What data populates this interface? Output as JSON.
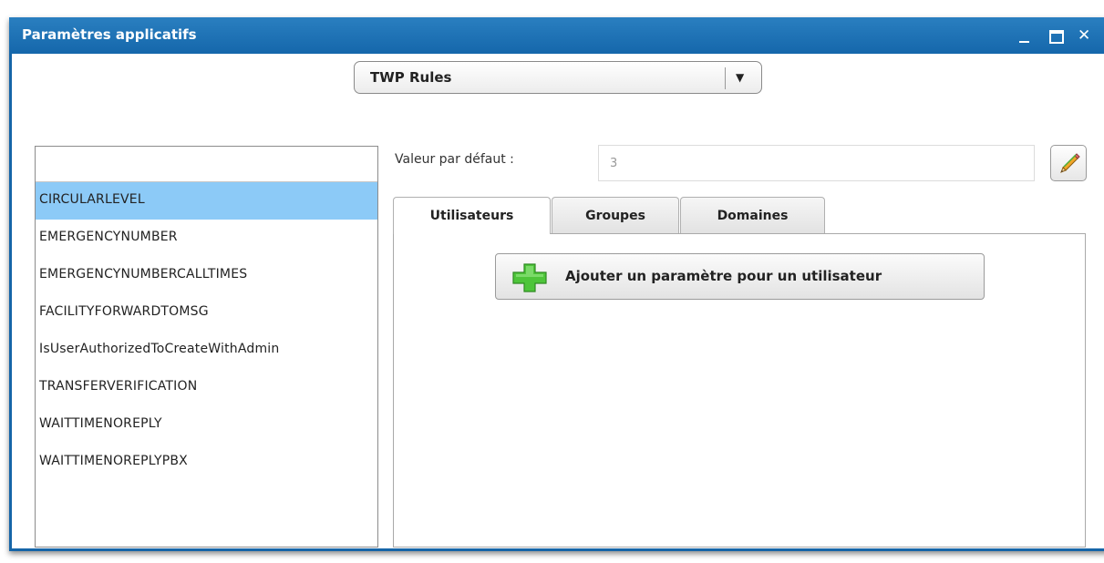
{
  "window": {
    "title": "Paramètres applicatifs",
    "controls": {
      "minimize": "_",
      "close": "✕"
    }
  },
  "combo": {
    "selected": "TWP Rules",
    "arrow": "▼"
  },
  "parameters": {
    "items": [
      "CIRCULARLEVEL",
      "EMERGENCYNUMBER",
      "EMERGENCYNUMBERCALLTIMES",
      "FACILITYFORWARDTOMSG",
      "IsUserAuthorizedToCreateWithAdmin",
      "TRANSFERVERIFICATION",
      "WAITTIMENOREPLY",
      "WAITTIMENOREPLYPBX"
    ],
    "selected_index": 0
  },
  "default_value": {
    "label": "Valeur par défaut :",
    "value": "3"
  },
  "tabs": [
    {
      "label": "Utilisateurs",
      "active": true
    },
    {
      "label": "Groupes",
      "active": false
    },
    {
      "label": "Domaines",
      "active": false
    }
  ],
  "add_button": {
    "label": "Ajouter un paramètre pour un utilisateur"
  },
  "icons": {
    "edit": "pencil-icon",
    "add": "plus-icon",
    "accent_green": "#4ec53a",
    "titlebar_blue": "#1e70b3",
    "selection_blue": "#8ccaf7"
  }
}
